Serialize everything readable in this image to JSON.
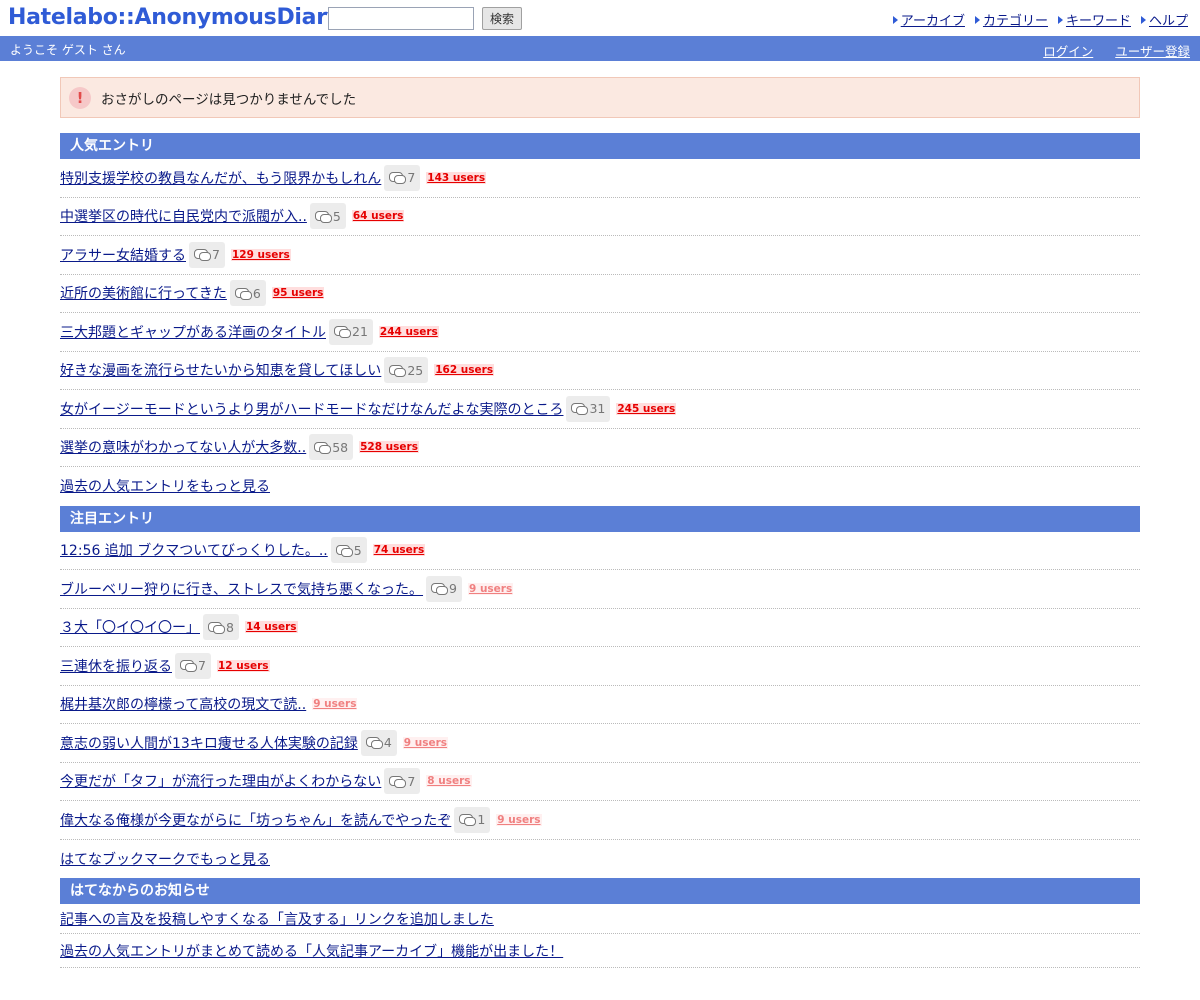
{
  "header": {
    "logo": "Hatelabo::AnonymousDiary",
    "search_button": "検索",
    "nav": [
      "アーカイブ",
      "カテゴリー",
      "キーワード",
      "ヘルプ"
    ]
  },
  "userbar": {
    "welcome": "ようこそ ゲスト さん",
    "login": "ログイン",
    "register": "ユーザー登録"
  },
  "notice": {
    "icon": "!",
    "message": "おさがしのページは見つかりませんでした"
  },
  "popular": {
    "title": "人気エントリ",
    "entries": [
      {
        "title": "特別支援学校の教員なんだが、もう限界かもしれん",
        "comments": "7",
        "users": "143 users",
        "heat": "hot"
      },
      {
        "title": "中選挙区の時代に自民党内で派閥が入..",
        "comments": "5",
        "users": "64 users",
        "heat": "hot"
      },
      {
        "title": "アラサー女結婚する",
        "comments": "7",
        "users": "129 users",
        "heat": "hot"
      },
      {
        "title": "近所の美術館に行ってきた",
        "comments": "6",
        "users": "95 users",
        "heat": "hot"
      },
      {
        "title": "三大邦題とギャップがある洋画のタイトル",
        "comments": "21",
        "users": "244 users",
        "heat": "hot"
      },
      {
        "title": "好きな漫画を流行らせたいから知恵を貸してほしい",
        "comments": "25",
        "users": "162 users",
        "heat": "hot"
      },
      {
        "title": "女がイージーモードというより男がハードモードなだけなんだよな実際のところ",
        "comments": "31",
        "users": "245 users",
        "heat": "hot"
      },
      {
        "title": "選挙の意味がわかってない人が大多数..",
        "comments": "58",
        "users": "528 users",
        "heat": "hot"
      }
    ],
    "more": "過去の人気エントリをもっと見る"
  },
  "attention": {
    "title": "注目エントリ",
    "entries": [
      {
        "title": "12:56 追加 ブクマついてびっくりした。..",
        "comments": "5",
        "users": "74 users",
        "heat": "hot"
      },
      {
        "title": "ブルーベリー狩りに行き、ストレスで気持ち悪くなった。",
        "comments": "9",
        "users": "9 users",
        "heat": "warm"
      },
      {
        "title": "３大「〇イ〇イ〇ー」",
        "comments": "8",
        "users": "14 users",
        "heat": "hot"
      },
      {
        "title": "三連休を振り返る",
        "comments": "7",
        "users": "12 users",
        "heat": "hot"
      },
      {
        "title": "梶井基次郎の檸檬って高校の現文で読..",
        "comments": "",
        "users": "9 users",
        "heat": "warm"
      },
      {
        "title": "意志の弱い人間が13キロ痩せる人体実験の記録",
        "comments": "4",
        "users": "9 users",
        "heat": "warm"
      },
      {
        "title": "今更だが「タフ」が流行った理由がよくわからない",
        "comments": "7",
        "users": "8 users",
        "heat": "warm"
      },
      {
        "title": "偉大なる俺様が今更ながらに「坊っちゃん」を読んでやったぞ",
        "comments": "1",
        "users": "9 users",
        "heat": "warm"
      }
    ],
    "more": "はてなブックマークでもっと見る"
  },
  "news": {
    "title": "はてなからのお知らせ",
    "entries": [
      "記事への言及を投稿しやすくなる「言及する」リンクを追加しました",
      "過去の人気エントリがまとめて読める「人気記事アーカイブ」機能が出ました！"
    ]
  }
}
